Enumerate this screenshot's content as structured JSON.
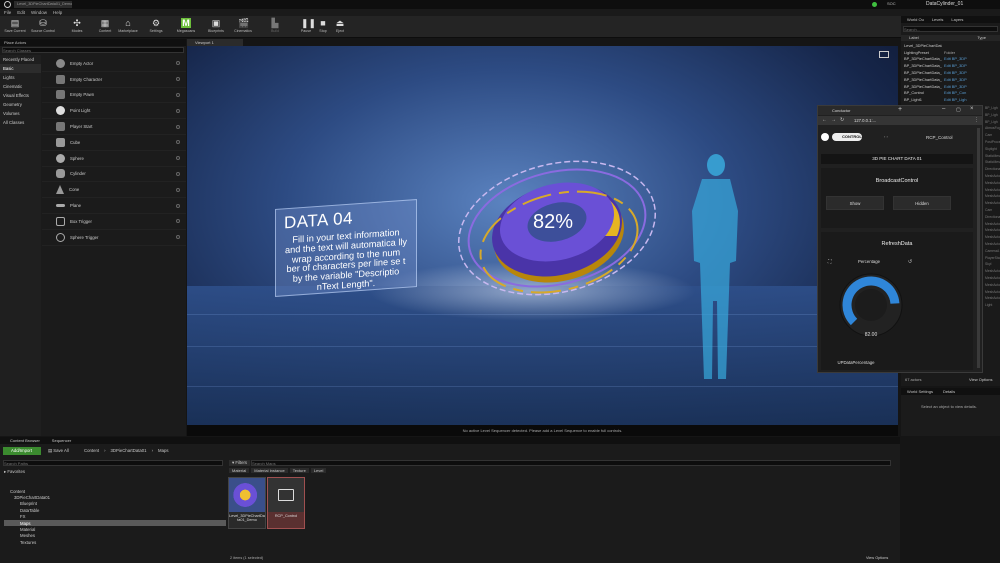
{
  "window": {
    "tab": "Level_3DPieChartData01_Demo",
    "project": "DataCylinder_01",
    "badge": "SOC"
  },
  "menu": [
    "File",
    "Edit",
    "Window",
    "Help"
  ],
  "toolbar": [
    {
      "label": "Save Current",
      "icon": "save-icon"
    },
    {
      "label": "Source Control",
      "icon": "source-control-icon"
    },
    {
      "label": "Modes",
      "icon": "modes-icon"
    },
    {
      "label": "Content",
      "icon": "content-icon"
    },
    {
      "label": "Marketplace",
      "icon": "marketplace-icon"
    },
    {
      "label": "Settings",
      "icon": "settings-icon"
    },
    {
      "label": "Megascans",
      "icon": "megascans-icon"
    },
    {
      "label": "Blueprints",
      "icon": "blueprints-icon"
    },
    {
      "label": "Cinematics",
      "icon": "cinematics-icon"
    },
    {
      "label": "Build",
      "icon": "build-icon"
    },
    {
      "label": "Pause",
      "icon": "pause-icon"
    },
    {
      "label": "Stop",
      "icon": "stop-icon"
    },
    {
      "label": "Eject",
      "icon": "eject-icon"
    }
  ],
  "place_actors": {
    "tab": "Place Actors",
    "search_placeholder": "Search Classes",
    "categories": [
      "Recently Placed",
      "Basic",
      "Lights",
      "Cinematic",
      "Visual Effects",
      "Geometry",
      "Volumes",
      "All Classes"
    ],
    "selected_category": "Basic",
    "actors": [
      "Empty Actor",
      "Empty Character",
      "Empty Pawn",
      "Point Light",
      "Player Start",
      "Cube",
      "Sphere",
      "Cylinder",
      "Cone",
      "Plane",
      "Box Trigger",
      "Sphere Trigger"
    ]
  },
  "viewport": {
    "tab": "Viewport 1",
    "card_title": "DATA 04",
    "card_text": "Fill in your text information and the text will automatica lly wrap according to the num ber of characters per line se t by the variable \"Descriptio nText Length\".",
    "pie_percent": "82%",
    "status": "No active Level Sequencer detected. Please add a Level Sequence to enable full controls."
  },
  "outliner": {
    "tabs": [
      "World Ou",
      "Levels",
      "Layers"
    ],
    "search_placeholder": "Search...",
    "col_label": "Label",
    "col_type": "Type",
    "rows": [
      {
        "label": "Level_3DPieChartData01_DeWorld",
        "type": ""
      },
      {
        "label": "LightingPreset",
        "type": "Folder"
      },
      {
        "label": "BP_3DPieChartData_A",
        "type": "Edit BP_3DP"
      },
      {
        "label": "BP_3DPieChartData_B",
        "type": "Edit BP_3DP"
      },
      {
        "label": "BP_3DPieChartData_C",
        "type": "Edit BP_3DP"
      },
      {
        "label": "BP_3DPieChartData_D",
        "type": "Edit BP_3DP"
      },
      {
        "label": "BP_3DPieChartData_E",
        "type": "Edit BP_3DP"
      },
      {
        "label": "BP_Control",
        "type": "Edit BP_Con"
      },
      {
        "label": "BP_Light1",
        "type": "Edit BP_Ligh"
      }
    ],
    "right_col": [
      "BP_Ligh",
      "BP_Ligh",
      "BP_Ligh",
      "AtmosFog",
      "Cam",
      "PostProcess",
      "Skylight",
      "StaticMesh",
      "StaticMesh",
      "Directional",
      "MeshActor",
      "MeshActor",
      "MeshActor",
      "MeshActor",
      "MeshActor",
      "Cam",
      "Directional",
      "MeshActor",
      "MeshActor",
      "MeshActor",
      "MeshActor",
      "CameraA",
      "PlayerStart",
      "Skyl",
      "MeshActor",
      "MeshActor",
      "MeshActor",
      "MeshActor",
      "MeshActor",
      "Light"
    ],
    "count": "67 actors",
    "view_options": "View Options"
  },
  "details": {
    "tabs": [
      "World Settings",
      "Details"
    ],
    "hint": "Select an object to view details."
  },
  "browser": {
    "tab": "Conductor",
    "url": "127.0.0.1:...",
    "brand": "CONTROL",
    "nav": "RCP_Control",
    "header": "3D PIE CHART DATA 01",
    "section1": "BroadcastControl",
    "show": "Show",
    "hidden": "Hidden",
    "section2": "RefreshData",
    "dial_label": "Percentage",
    "dial_value": "82.00",
    "dial_percent": 82,
    "button": "UPDataPercentage"
  },
  "content_browser": {
    "tabs": [
      "Content Browser",
      "Sequencer"
    ],
    "add_import": "Add/Import",
    "save_all": "Save All",
    "breadcrumb": [
      "Content",
      "3DPieChartData01",
      "Maps"
    ],
    "filters": "Filters",
    "search_paths": "Search Paths",
    "search_maps": "Search Maps",
    "filter_tabs": [
      "Material",
      "Material Instance",
      "Texture",
      "Level"
    ],
    "favorites": "Favorites",
    "tree": [
      "Content",
      "3DPieChartData01",
      "Blueprint",
      "DataTable",
      "FX",
      "Maps",
      "Material",
      "Meshes",
      "Textures"
    ],
    "assets": [
      {
        "name": "Level_3DPieChartData01_Demo"
      },
      {
        "name": "RCP_Control"
      }
    ],
    "status": "2 items (1 selected)",
    "view_options": "View Options"
  },
  "colors": {
    "accent": "#2a7de1",
    "pie_purple": "#6a4fd0",
    "pie_gold": "#e0b020",
    "selection": "#3a3a3a"
  }
}
